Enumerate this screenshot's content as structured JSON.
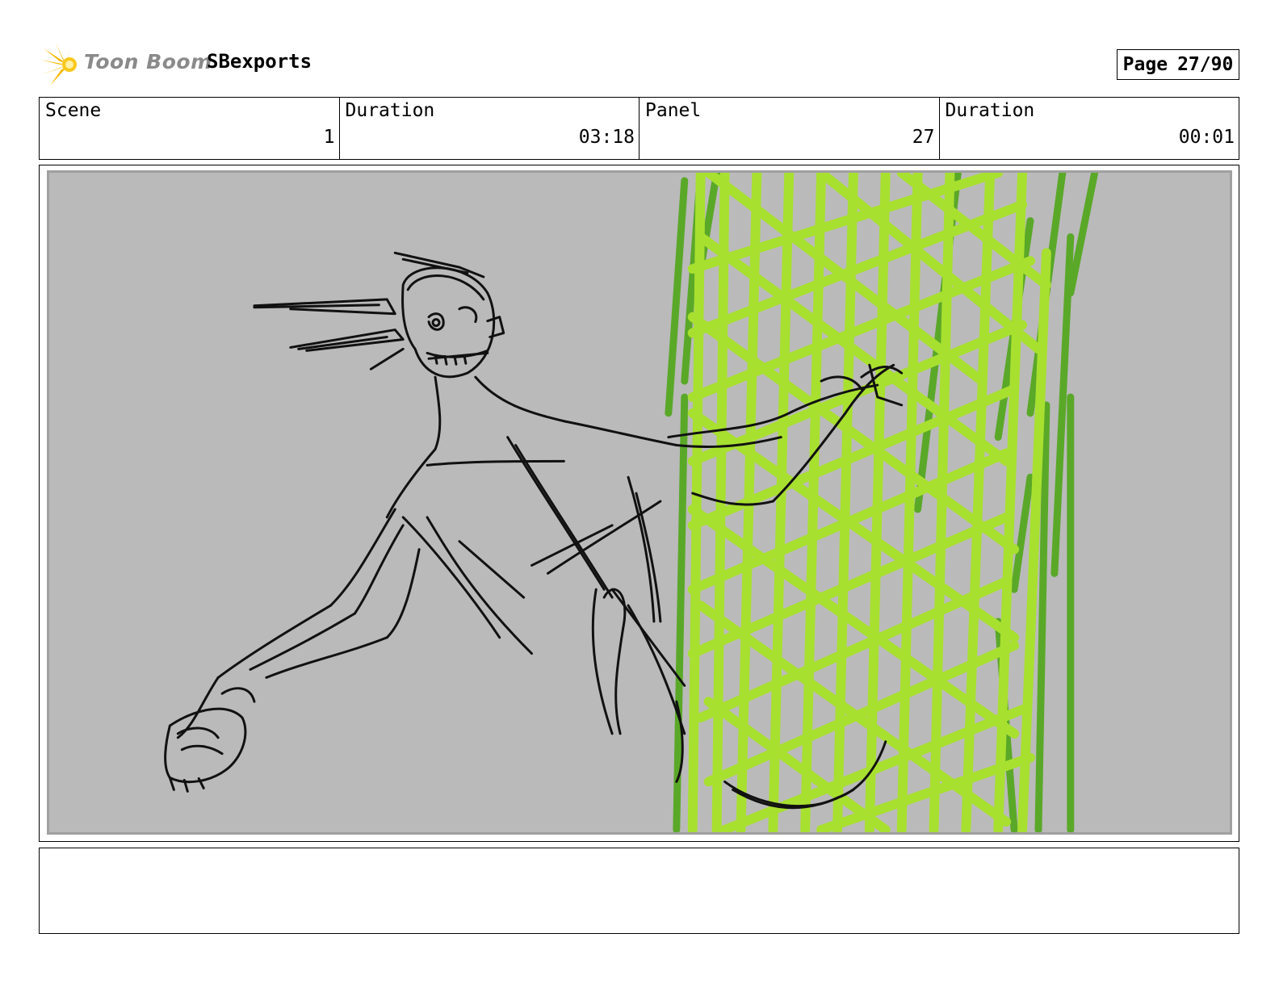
{
  "header": {
    "logo_text": "Toon Boom",
    "project_name": "SBexports",
    "page_label": "Page",
    "page_value": "27/90"
  },
  "info": {
    "scene_label": "Scene",
    "scene_value": "1",
    "scene_duration_label": "Duration",
    "scene_duration_value": "03:18",
    "panel_label": "Panel",
    "panel_value": "27",
    "panel_duration_label": "Duration",
    "panel_duration_value": "00:01"
  },
  "panel_image": {
    "background_color": "#bababa",
    "sketch_color": "#111111",
    "foliage_light_color": "#a8e030",
    "foliage_dark_color": "#5aa828"
  },
  "notes": {
    "text": ""
  }
}
